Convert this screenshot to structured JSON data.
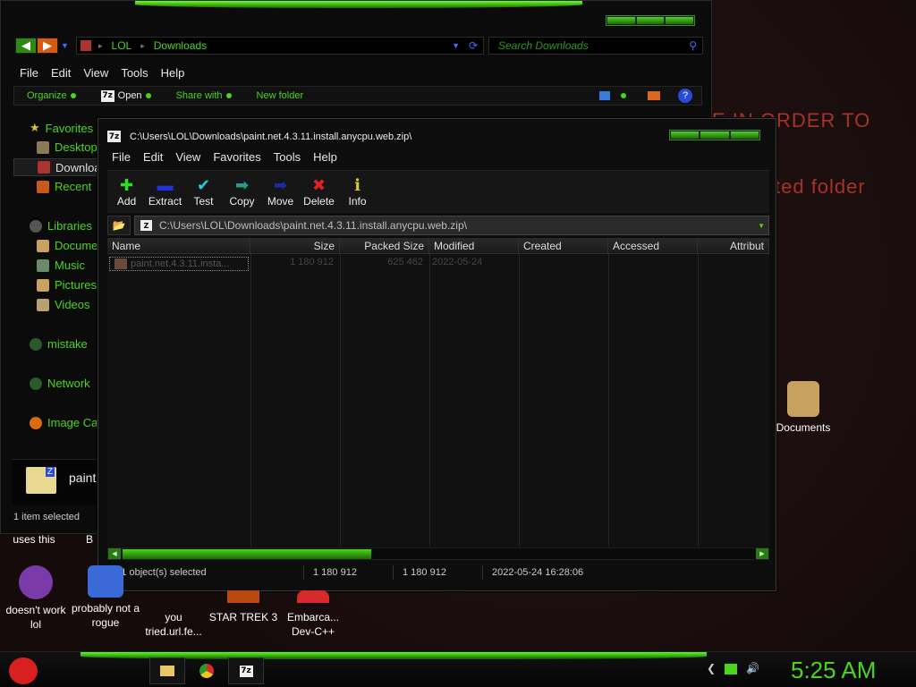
{
  "desktop": {
    "bg_line1": "E IN ORDER TO",
    "bg_line2": "ted folder",
    "icons": [
      {
        "label": "doesn't work lol"
      },
      {
        "label": "probably not a rogue"
      },
      {
        "label": "you tried.url.fe..."
      },
      {
        "label": "STAR TREK 3"
      },
      {
        "label": "Embarca... Dev-C++"
      },
      {
        "label": "Documents"
      }
    ],
    "partial_labels": {
      "uses_this": "uses this",
      "b": "B"
    }
  },
  "explorer": {
    "breadcrumb": [
      "LOL",
      "Downloads"
    ],
    "search_placeholder": "Search Downloads",
    "menu": [
      "File",
      "Edit",
      "View",
      "Tools",
      "Help"
    ],
    "commands": [
      "Organize",
      "Open",
      "Share with",
      "New folder"
    ],
    "nav": {
      "favorites": "Favorites",
      "desktop": "Desktop",
      "downloads": "Downloa",
      "recent": "Recent",
      "libraries": "Libraries",
      "documents": "Docume",
      "music": "Music",
      "pictures": "Pictures",
      "videos": "Videos",
      "mistake": "mistake",
      "network": "Network",
      "image_cache": "Image Ca"
    },
    "preview_name": "paint",
    "status": "1 item selected"
  },
  "zip": {
    "title": "C:\\Users\\LOL\\Downloads\\paint.net.4.3.11.install.anycpu.web.zip\\",
    "menu": [
      "File",
      "Edit",
      "View",
      "Favorites",
      "Tools",
      "Help"
    ],
    "tools": [
      {
        "label": "Add",
        "icon": "plus-icon",
        "color": "#33dd22"
      },
      {
        "label": "Extract",
        "icon": "minus-icon",
        "color": "#2233dd"
      },
      {
        "label": "Test",
        "icon": "check-icon",
        "color": "#22ccdd"
      },
      {
        "label": "Copy",
        "icon": "copy-arrow-icon",
        "color": "#2a9a8a"
      },
      {
        "label": "Move",
        "icon": "move-arrow-icon",
        "color": "#1a2aaa"
      },
      {
        "label": "Delete",
        "icon": "x-icon",
        "color": "#dd2222"
      },
      {
        "label": "Info",
        "icon": "info-icon",
        "color": "#ddcc22"
      }
    ],
    "path": "C:\\Users\\LOL\\Downloads\\paint.net.4.3.11.install.anycpu.web.zip\\",
    "columns": [
      "Name",
      "Size",
      "Packed Size",
      "Modified",
      "Created",
      "Accessed",
      "Attribut"
    ],
    "rows": [
      {
        "name": "paint.net.4.3.11.insta...",
        "size": "1 180 912",
        "packed": "625 462",
        "modified": "2022-05-24"
      }
    ],
    "status": {
      "selected": "1 / 1 object(s) selected",
      "size": "1 180 912",
      "packed": "1 180 912",
      "modified": "2022-05-24 16:28:06"
    }
  },
  "taskbar": {
    "clock": "5:25 AM"
  }
}
